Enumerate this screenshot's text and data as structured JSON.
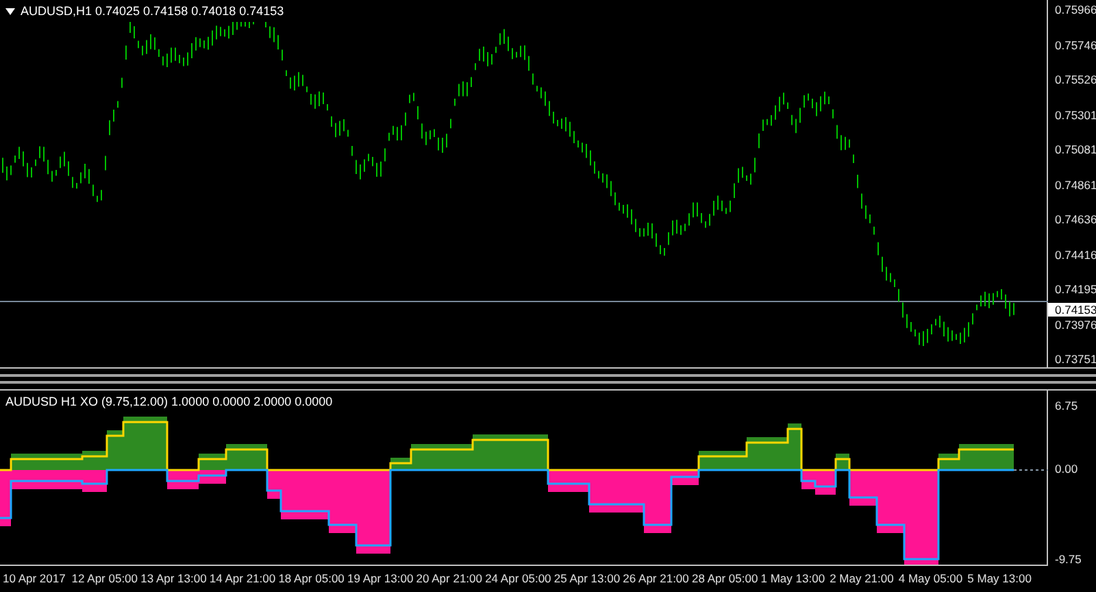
{
  "price_chart": {
    "title": "AUDUSD,H1  0.74025 0.74158 0.74018 0.74153",
    "price_axis": [
      "0.75966",
      "0.75746",
      "0.75526",
      "0.75301",
      "0.75081",
      "0.74861",
      "0.74636",
      "0.74416",
      "0.74195",
      "0.73976",
      "0.73751"
    ],
    "current_price": "0.74153"
  },
  "indicator": {
    "title": "AUDUSD H1 XO (9.75,12.00) 1.0000 0.0000 2.0000 0.0000",
    "axis": [
      "6.75",
      "0.00",
      "-9.75"
    ]
  },
  "time_axis": [
    "10 Apr 2017",
    "12 Apr 05:00",
    "13 Apr 13:00",
    "14 Apr 21:00",
    "18 Apr 05:00",
    "19 Apr 13:00",
    "20 Apr 21:00",
    "24 Apr 05:00",
    "25 Apr 13:00",
    "26 Apr 21:00",
    "28 Apr 05:00",
    "1 May 13:00",
    "2 May 21:00",
    "4 May 05:00",
    "5 May 13:00"
  ]
}
